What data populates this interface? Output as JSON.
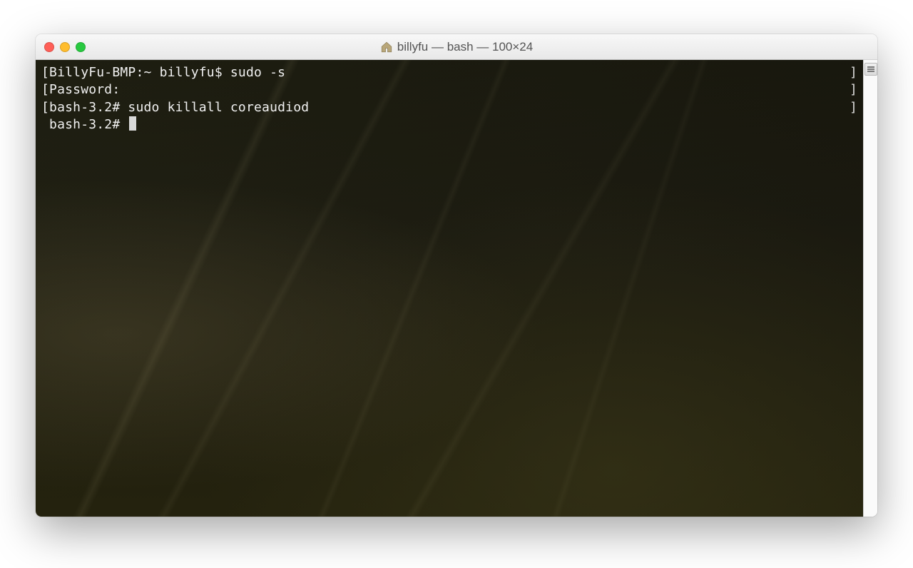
{
  "window": {
    "title": "billyfu — bash — 100×24"
  },
  "terminal": {
    "lines": [
      {
        "left_bracket": "[",
        "text": "BillyFu-BMP:~ billyfu$ sudo -s",
        "right_bracket": "]"
      },
      {
        "left_bracket": "[",
        "text": "Password:",
        "right_bracket": "]"
      },
      {
        "left_bracket": "[",
        "text": "bash-3.2# sudo killall coreaudiod",
        "right_bracket": "]"
      },
      {
        "left_bracket": " ",
        "text": "bash-3.2# ",
        "right_bracket": "",
        "cursor": true
      }
    ]
  },
  "icons": {
    "home": "home-icon"
  }
}
